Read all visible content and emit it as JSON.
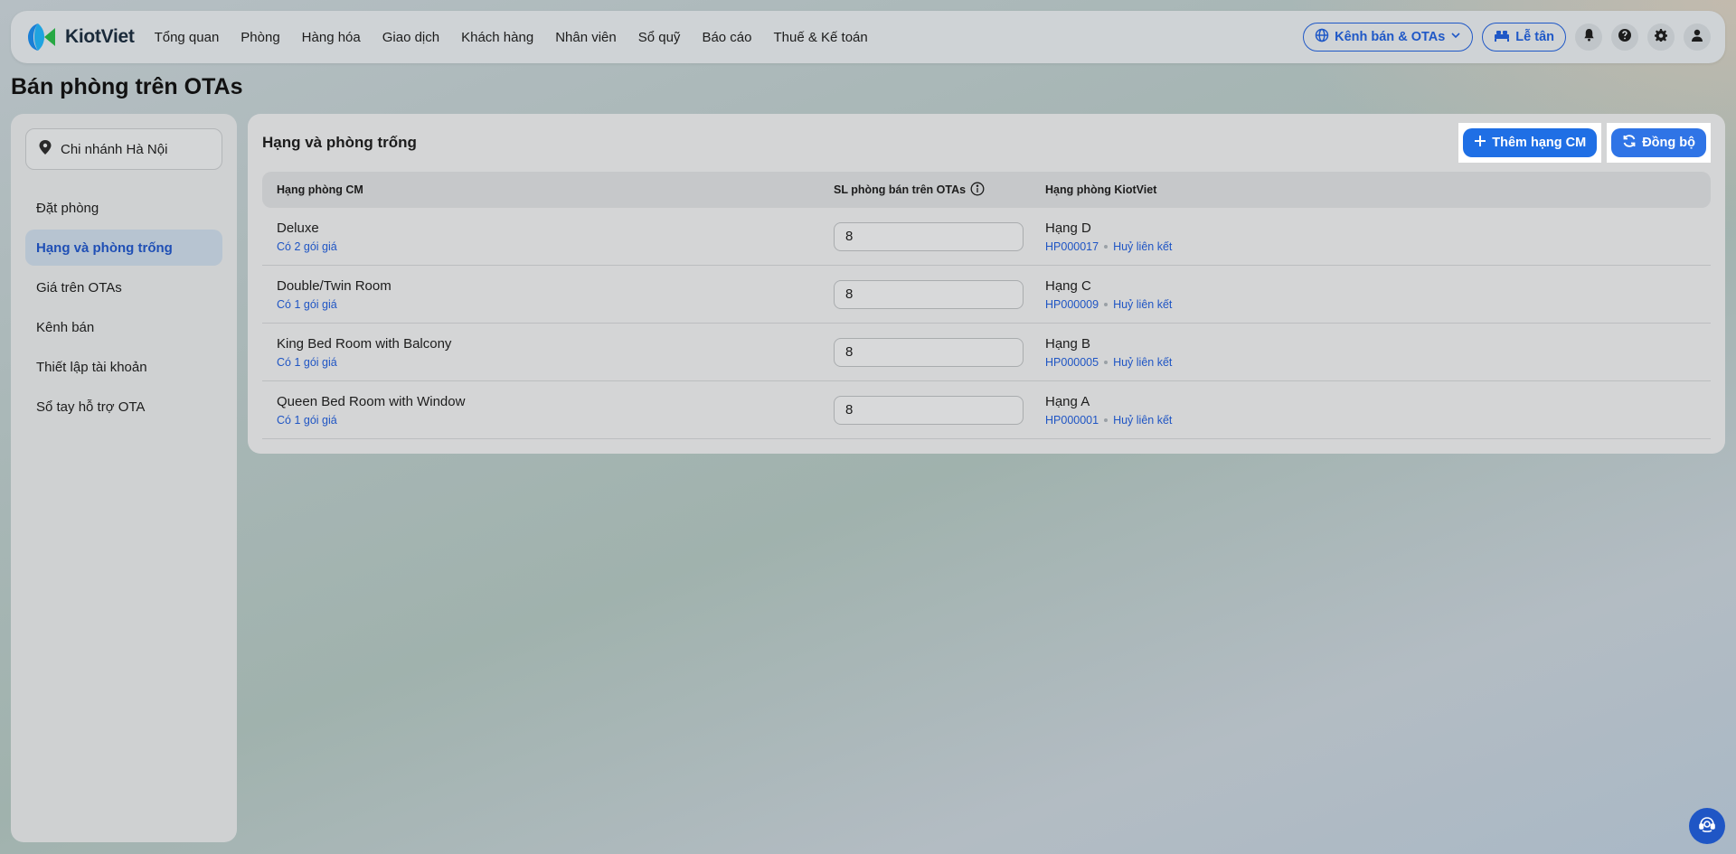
{
  "app": {
    "name": "KiotViet"
  },
  "nav": {
    "items": [
      "Tổng quan",
      "Phòng",
      "Hàng hóa",
      "Giao dịch",
      "Khách hàng",
      "Nhân viên",
      "Sổ quỹ",
      "Báo cáo",
      "Thuế & Kế toán"
    ],
    "channel_button": "Kênh bán & OTAs",
    "reception_button": "Lễ tân"
  },
  "page": {
    "title": "Bán phòng trên OTAs"
  },
  "sidebar": {
    "branch": "Chi nhánh Hà Nội",
    "items": [
      {
        "label": "Đặt phòng",
        "active": false
      },
      {
        "label": "Hạng và phòng trống",
        "active": true
      },
      {
        "label": "Giá trên OTAs",
        "active": false
      },
      {
        "label": "Kênh bán",
        "active": false
      },
      {
        "label": "Thiết lập tài khoản",
        "active": false
      },
      {
        "label": "Sổ tay hỗ trợ OTA",
        "active": false
      }
    ]
  },
  "main": {
    "title": "Hạng và phòng trống",
    "add_button": "Thêm hạng CM",
    "sync_button": "Đồng bộ",
    "columns": [
      "Hạng phòng CM",
      "SL phòng bán trên OTAs",
      "Hạng phòng KiotViet"
    ],
    "rows": [
      {
        "name": "Deluxe",
        "packages": "Có 2 gói giá",
        "qty": "8",
        "kv_class": "Hạng D",
        "kv_code": "HP000017",
        "unlink": "Huỷ liên kết"
      },
      {
        "name": "Double/Twin Room",
        "packages": "Có 1 gói giá",
        "qty": "8",
        "kv_class": "Hạng C",
        "kv_code": "HP000009",
        "unlink": "Huỷ liên kết"
      },
      {
        "name": "King Bed Room with Balcony",
        "packages": "Có 1 gói giá",
        "qty": "8",
        "kv_class": "Hạng B",
        "kv_code": "HP000005",
        "unlink": "Huỷ liên kết"
      },
      {
        "name": "Queen Bed Room with Window",
        "packages": "Có 1 gói giá",
        "qty": "8",
        "kv_class": "Hạng A",
        "kv_code": "HP000001",
        "unlink": "Huỷ liên kết"
      }
    ]
  },
  "colors": {
    "accent": "#1f6fe5",
    "link": "#1f55c4",
    "active_bg": "#b7c4d1"
  }
}
